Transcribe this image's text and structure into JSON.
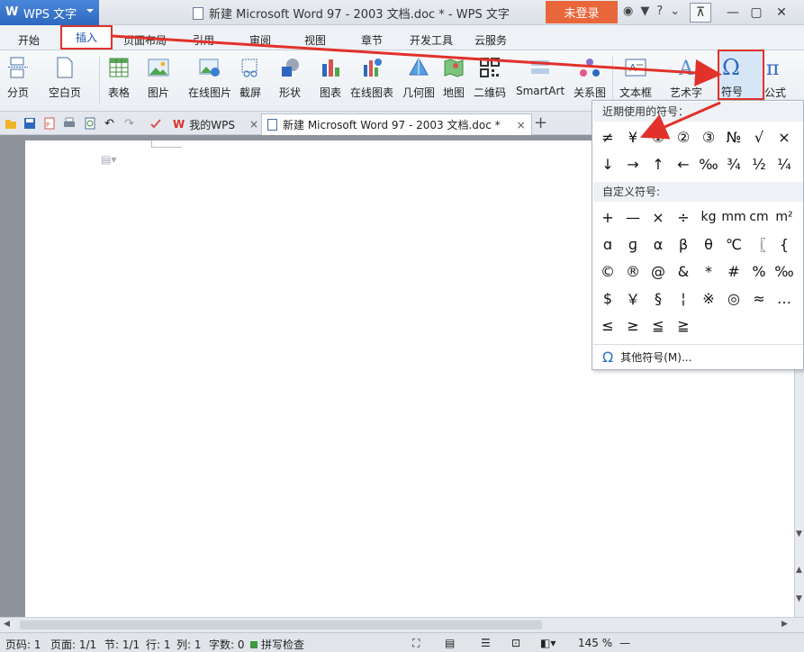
{
  "app": {
    "name": "WPS 文字"
  },
  "window": {
    "title": "新建 Microsoft Word 97 - 2003 文档.doc * - WPS 文字",
    "login_label": "未登录"
  },
  "tabs": [
    {
      "label": "开始"
    },
    {
      "label": "插入"
    },
    {
      "label": "页面布局"
    },
    {
      "label": "引用"
    },
    {
      "label": "审阅"
    },
    {
      "label": "视图"
    },
    {
      "label": "章节"
    },
    {
      "label": "开发工具"
    },
    {
      "label": "云服务"
    }
  ],
  "ribbon": {
    "items": [
      {
        "label": "分页",
        "icon": "page-break-icon"
      },
      {
        "label": "空白页",
        "icon": "blank-page-icon"
      },
      {
        "label": "表格",
        "icon": "table-icon"
      },
      {
        "label": "图片",
        "icon": "picture-icon"
      },
      {
        "label": "在线图片",
        "icon": "online-picture-icon"
      },
      {
        "label": "截屏",
        "icon": "screenshot-icon"
      },
      {
        "label": "形状",
        "icon": "shape-icon"
      },
      {
        "label": "图表",
        "icon": "chart-icon"
      },
      {
        "label": "在线图表",
        "icon": "online-chart-icon"
      },
      {
        "label": "几何图",
        "icon": "geometry-icon"
      },
      {
        "label": "地图",
        "icon": "map-icon"
      },
      {
        "label": "二维码",
        "icon": "qrcode-icon"
      },
      {
        "label": "SmartArt",
        "icon": "smartart-icon"
      },
      {
        "label": "关系图",
        "icon": "relation-icon"
      },
      {
        "label": "文本框",
        "icon": "textbox-icon"
      },
      {
        "label": "艺术字",
        "icon": "wordart-icon"
      },
      {
        "label": "符号",
        "icon": "omega-icon"
      },
      {
        "label": "公式",
        "icon": "pi-icon"
      }
    ]
  },
  "doc_tabs": [
    {
      "label": "我的WPS"
    },
    {
      "label": "新建 Microsoft Word 97 - 2003 文档.doc *"
    }
  ],
  "symbol_menu": {
    "recent_title": "近期使用的符号：",
    "recent": [
      "≠",
      "¥",
      "①",
      "②",
      "③",
      "№",
      "√",
      "×",
      "↓",
      "→",
      "↑",
      "←",
      "‰",
      "¾",
      "½",
      "¼"
    ],
    "custom_title": "自定义符号:",
    "custom": [
      "+",
      "—",
      "×",
      "÷",
      "kg",
      "mm",
      "cm",
      "m²",
      "ɑ",
      "ɡ",
      "α",
      "β",
      "θ",
      "℃",
      "〖",
      "{",
      "©",
      "®",
      "@",
      "&",
      "*",
      "#",
      "%",
      "‰",
      "$",
      "￥",
      "§",
      "¦",
      "※",
      "◎",
      "≈",
      "…",
      "≤",
      "≥",
      "≦",
      "≧"
    ],
    "more_label": "其他符号(M)..."
  },
  "statusbar": {
    "page_no": "页码: 1",
    "pages": "页面: 1/1",
    "section": "节: 1/1",
    "row": "行: 1",
    "col": "列: 1",
    "words": "字数: 0",
    "spell": "拼写检查",
    "zoom": "145 %"
  },
  "colors": {
    "accent": "#2d68c0",
    "highlight": "#e2312b",
    "login": "#e8663a"
  }
}
